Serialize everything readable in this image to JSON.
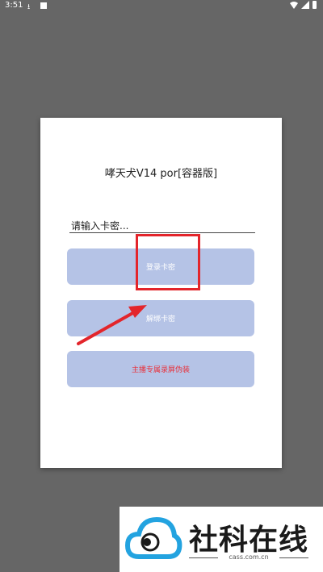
{
  "status_bar": {
    "time": "3:51"
  },
  "dialog": {
    "title": "哮天犬V14 por[容器版]",
    "key_input": {
      "placeholder": "请输入卡密...",
      "value": ""
    },
    "login_button": "登录卡密",
    "unbind_button": "解绑卡密",
    "disguise_button": "主播专属录屏伪装"
  },
  "watermark": {
    "name": "社科在线",
    "domain": "cass.com.cn"
  },
  "colors": {
    "backdrop": "#666666",
    "button": "#b5c3e6",
    "disguise_text": "#e8313b",
    "annotation": "#e3252b",
    "logo_blue": "#23a3e0"
  }
}
